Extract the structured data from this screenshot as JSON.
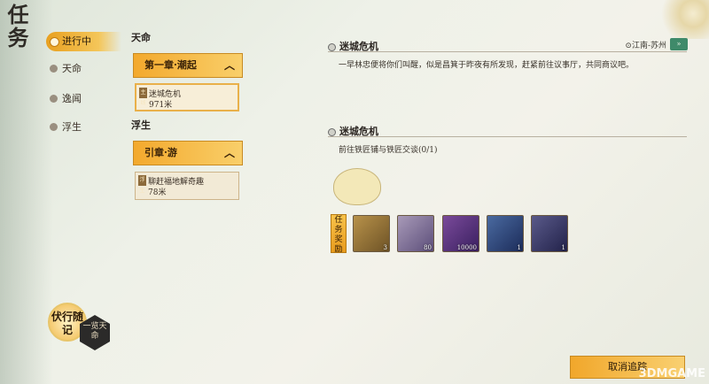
{
  "title_callig": "任务",
  "sidebar": {
    "items": [
      {
        "label": "进行中"
      },
      {
        "label": "天命"
      },
      {
        "label": "逸闻"
      },
      {
        "label": "浮生"
      }
    ]
  },
  "quest_list": {
    "group1_title": "天命",
    "group1_chapter": "第一章·潮起",
    "group1_quest": {
      "badge": "主线",
      "name": "迷城危机",
      "distance": "971米"
    },
    "group2_title": "浮生",
    "group2_chapter": "引章·游",
    "group2_quest": {
      "badge": "浮生",
      "name": "聊赶福地解奇趣",
      "distance": "78米"
    }
  },
  "detail": {
    "section1_title": "迷城危机",
    "location": "江南-苏州",
    "location_btn": "»",
    "description": "一早林忠便将你们叫醒，似是昌箕于昨夜有所发现，赶紧前往议事厅，共同商议吧。",
    "section2_title": "迷城危机",
    "objective": "前往铁匠铺与铁匠交谈(0/1)"
  },
  "rewards": {
    "label": "任务奖励",
    "items": [
      {
        "name": "jade-item",
        "count": "3",
        "color": "#8a6a30"
      },
      {
        "name": "crystal-item",
        "count": "80",
        "color": "#6a5a8a"
      },
      {
        "name": "coin-book-item",
        "count": "10000",
        "color": "#5a3a7a"
      },
      {
        "name": "pouch-item",
        "count": "1",
        "color": "#2a4a7a"
      },
      {
        "name": "portrait-item",
        "count": "1",
        "color": "#3a3a6a"
      }
    ]
  },
  "tracker": {
    "label": "伏行随记",
    "hex_label": "一览天命"
  },
  "cancel_btn": "取消追踪",
  "watermark": "3DMGAME"
}
